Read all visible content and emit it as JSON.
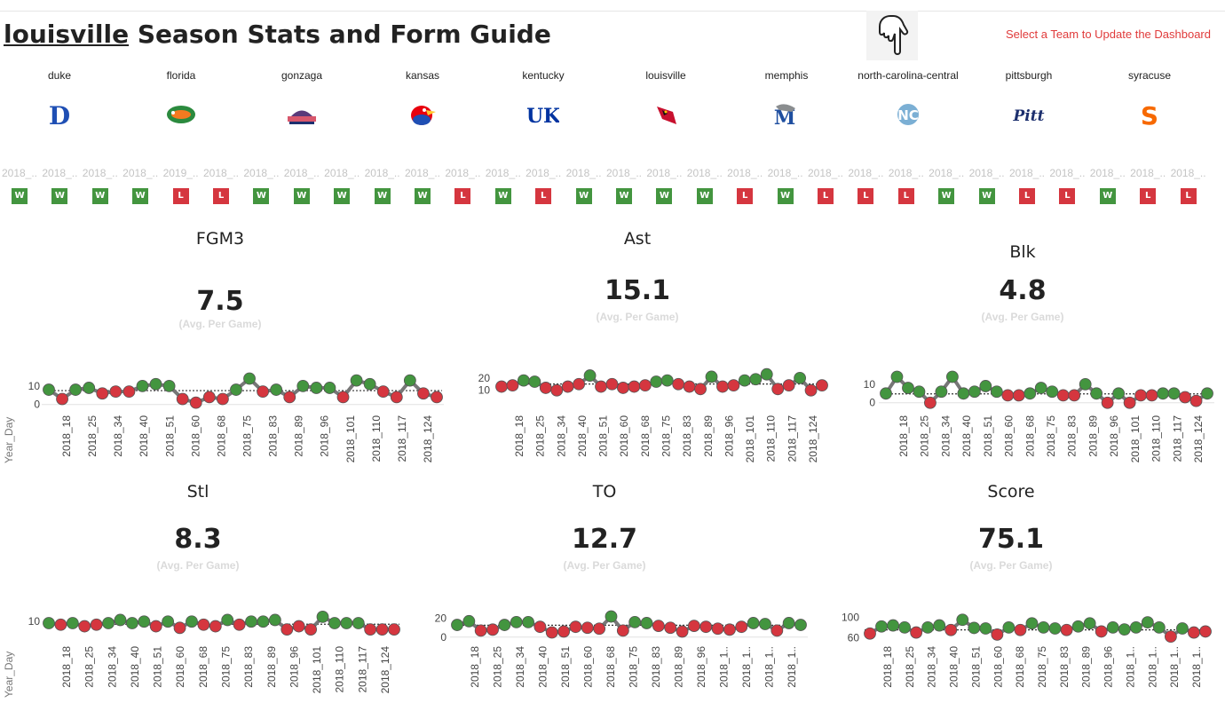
{
  "header": {
    "team": "louisville",
    "title_rest": " Season Stats and Form Guide",
    "hint": "Select a Team to Update the Dashboard",
    "hand_icon": "pointing-hand-icon"
  },
  "teams": [
    {
      "name": "duke",
      "logo": "duke-logo",
      "color": "#1f4fb4"
    },
    {
      "name": "florida",
      "logo": "florida-gator-logo",
      "color": "#2b8a3e"
    },
    {
      "name": "gonzaga",
      "logo": "gonzaga-logo",
      "color": "#5a3a7a"
    },
    {
      "name": "kansas",
      "logo": "kansas-jayhawk-logo",
      "color": "#1f4fb4"
    },
    {
      "name": "kentucky",
      "logo": "kentucky-uk-logo",
      "color": "#0033a0"
    },
    {
      "name": "louisville",
      "logo": "louisville-cardinal-logo",
      "color": "#c8102e"
    },
    {
      "name": "memphis",
      "logo": "memphis-tiger-logo",
      "color": "#1f4fa0"
    },
    {
      "name": "north-carolina-central",
      "logo": "nc-logo",
      "color": "#7bafd4"
    },
    {
      "name": "pittsburgh",
      "logo": "pitt-logo",
      "color": "#1c2f6e"
    },
    {
      "name": "syracuse",
      "logo": "syracuse-s-logo",
      "color": "#f76900"
    }
  ],
  "form": {
    "date_labels": [
      "2018_..",
      "2018_..",
      "2018_..",
      "2018_..",
      "2019_..",
      "2018_..",
      "2018_..",
      "2018_..",
      "2018_..",
      "2018_..",
      "2018_..",
      "2018_..",
      "2018_..",
      "2018_..",
      "2018_..",
      "2018_..",
      "2018_..",
      "2018_..",
      "2018_..",
      "2018_..",
      "2018_..",
      "2018_..",
      "2018_..",
      "2018_..",
      "2018_..",
      "2018_..",
      "2018_..",
      "2018_..",
      "2018_..",
      "2018_.."
    ],
    "results": [
      "W",
      "W",
      "W",
      "W",
      "L",
      "L",
      "W",
      "W",
      "W",
      "W",
      "W",
      "L",
      "W",
      "L",
      "W",
      "W",
      "W",
      "W",
      "L",
      "W",
      "L",
      "L",
      "L",
      "W",
      "W",
      "L",
      "L",
      "W",
      "L",
      "L"
    ],
    "win_color": "#43953f",
    "loss_color": "#d5363f"
  },
  "panels": [
    {
      "id": "fgm3",
      "title": "FGM3",
      "value": "7.5",
      "sub": "(Avg. Per Game)"
    },
    {
      "id": "ast",
      "title": "Ast",
      "value": "15.1",
      "sub": "(Avg. Per Game)"
    },
    {
      "id": "blk",
      "title": "Blk",
      "value": "4.8",
      "sub": "(Avg. Per Game)"
    },
    {
      "id": "stl",
      "title": "Stl",
      "value": "8.3",
      "sub": "(Avg. Per Game)"
    },
    {
      "id": "to",
      "title": "TO",
      "value": "12.7",
      "sub": "(Avg. Per Game)"
    },
    {
      "id": "score",
      "title": "Score",
      "value": "75.1",
      "sub": "(Avg. Per Game)"
    }
  ],
  "axis_title": "Year_Day",
  "chart_data": [
    {
      "type": "line",
      "id": "fgm3",
      "xlabel": "Year_Day",
      "ylabel": "",
      "average": 7.5,
      "ticks_y": [
        0,
        10
      ],
      "ylim": [
        -3,
        20
      ],
      "tick_labels": [
        "2018_18",
        "2018_25",
        "2018_34",
        "2018_40",
        "2018_51",
        "2018_60",
        "2018_68",
        "2018_75",
        "2018_83",
        "2018_89",
        "2018_96",
        "2018_101",
        "2018_110",
        "2018_117",
        "2018_124"
      ],
      "values": [
        8,
        3,
        8,
        9,
        6,
        7,
        7,
        10,
        11,
        10,
        3,
        1,
        4,
        3,
        8,
        14,
        7,
        8,
        4,
        10,
        9,
        9,
        4,
        13,
        11,
        7,
        4,
        13,
        6,
        4
      ]
    },
    {
      "type": "line",
      "id": "ast",
      "xlabel": "Year_Day",
      "ylabel": "",
      "average": 15.1,
      "ticks_y": [
        10,
        20
      ],
      "ylim": [
        4,
        30
      ],
      "tick_labels": [
        "2018_18",
        "2018_25",
        "2018_34",
        "2018_40",
        "2018_51",
        "2018_60",
        "2018_68",
        "2018_75",
        "2018_83",
        "2018_89",
        "2018_96",
        "2018_101",
        "2018_110",
        "2018_117",
        "2018_124"
      ],
      "values": [
        13,
        14,
        18,
        17,
        12,
        10,
        13,
        15,
        22,
        13,
        15,
        12,
        13,
        14,
        17,
        18,
        15,
        13,
        11,
        21,
        13,
        14,
        18,
        19,
        23,
        11,
        14,
        20,
        10,
        14
      ]
    },
    {
      "type": "line",
      "id": "blk",
      "xlabel": "Year_Day",
      "ylabel": "",
      "average": 4.8,
      "ticks_y": [
        0,
        10
      ],
      "ylim": [
        -3,
        20
      ],
      "tick_labels": [
        "2018_18",
        "2018_25",
        "2018_34",
        "2018_40",
        "2018_51",
        "2018_60",
        "2018_68",
        "2018_75",
        "2018_83",
        "2018_89",
        "2018_96",
        "2018_101",
        "2018_110",
        "2018_117",
        "2018_124"
      ],
      "values": [
        5,
        14,
        8,
        6,
        0,
        6,
        14,
        5,
        6,
        9,
        6,
        4,
        4,
        5,
        8,
        6,
        4,
        4,
        10,
        5,
        0,
        5,
        0,
        4,
        4,
        5,
        5,
        3,
        1,
        5
      ]
    },
    {
      "type": "line",
      "id": "stl",
      "xlabel": "Year_Day",
      "ylabel": "",
      "average": 8.3,
      "ticks_y": [
        10
      ],
      "ylim": [
        0,
        18
      ],
      "tick_labels": [
        "2018_18",
        "2018_25",
        "2018_34",
        "2018_40",
        "2018_51",
        "2018_60",
        "2018_68",
        "2018_75",
        "2018_83",
        "2018_89",
        "2018_96",
        "2018_101",
        "2018_110",
        "2018_117",
        "2018_124"
      ],
      "values": [
        9,
        8,
        9,
        7,
        8,
        9,
        11,
        9,
        10,
        7,
        10,
        6,
        10,
        8,
        7,
        11,
        8,
        10,
        10,
        11,
        5,
        7,
        5,
        13,
        9,
        9,
        9,
        5,
        5,
        5
      ]
    },
    {
      "type": "line",
      "id": "to",
      "xlabel": "Year_Day",
      "ylabel": "",
      "average": 12.7,
      "ticks_y": [
        0,
        20
      ],
      "ylim": [
        -4,
        32
      ],
      "tick_labels": [
        "2018_18",
        "2018_25",
        "2018_34",
        "2018_40",
        "2018_51",
        "2018_60",
        "2018_68",
        "2018_75",
        "2018_83",
        "2018_89",
        "2018_96",
        "2018_1..",
        "2018_1..",
        "2018_1..",
        "2018_1.."
      ],
      "values": [
        13,
        17,
        7,
        8,
        13,
        16,
        16,
        11,
        5,
        6,
        11,
        10,
        9,
        22,
        7,
        16,
        15,
        12,
        10,
        6,
        12,
        11,
        9,
        8,
        11,
        15,
        14,
        7,
        15,
        13
      ]
    },
    {
      "type": "line",
      "id": "score",
      "xlabel": "Year_Day",
      "ylabel": "",
      "average": 75.1,
      "ticks_y": [
        60,
        100
      ],
      "ylim": [
        50,
        120
      ],
      "tick_labels": [
        "2018_18",
        "2018_25",
        "2018_34",
        "2018_40",
        "2018_51",
        "2018_60",
        "2018_68",
        "2018_75",
        "2018_83",
        "2018_89",
        "2018_96",
        "2018_1..",
        "2018_1..",
        "2018_1..",
        "2018_1.."
      ],
      "values": [
        68,
        82,
        84,
        80,
        70,
        80,
        84,
        75,
        95,
        79,
        78,
        66,
        80,
        75,
        88,
        80,
        78,
        75,
        82,
        88,
        72,
        80,
        76,
        80,
        90,
        80,
        62,
        78,
        70,
        72
      ]
    }
  ]
}
